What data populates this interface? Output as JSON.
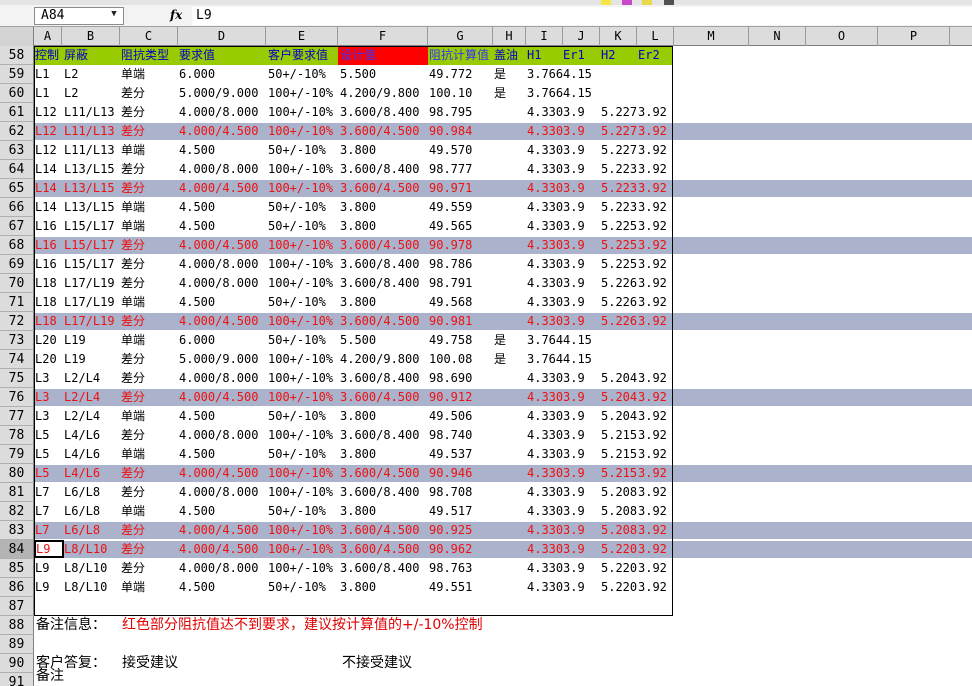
{
  "formula_bar": {
    "name_box": "A84",
    "fx_label": "fx",
    "formula": "L9"
  },
  "columns": [
    "A",
    "B",
    "C",
    "D",
    "E",
    "F",
    "G",
    "H",
    "I",
    "J",
    "K",
    "L",
    "M",
    "N",
    "O",
    "P"
  ],
  "colors": {
    "header_band": "#99cc00",
    "header_text": "#0000cc",
    "highlight_band": "#aab2cc",
    "highlight_text": "#ee1111",
    "header_red_fill": "#ff0000"
  },
  "header_row": {
    "row": "58",
    "cells": [
      "控制",
      "屏蔽",
      "阻抗类型",
      "要求值",
      "客户要求值",
      "设计值",
      "阻抗计算值",
      "盖油",
      "H1",
      "Er1",
      "H2",
      "Er2"
    ]
  },
  "rows": [
    {
      "row": "59",
      "hl": false,
      "cells": [
        "L1",
        "L2",
        "单端",
        "6.000",
        "50+/-10%",
        "5.500",
        "49.772",
        "是",
        "3.766",
        "4.15",
        "",
        ""
      ]
    },
    {
      "row": "60",
      "hl": false,
      "cells": [
        "L1",
        "L2",
        "差分",
        "5.000/9.000",
        "100+/-10%",
        "4.200/9.800",
        "100.10",
        "是",
        "3.766",
        "4.15",
        "",
        ""
      ]
    },
    {
      "row": "61",
      "hl": false,
      "cells": [
        "L12",
        "L11/L13",
        "差分",
        "4.000/8.000",
        "100+/-10%",
        "3.600/8.400",
        "98.795",
        "",
        "4.330",
        "3.9",
        "5.227",
        "3.92"
      ]
    },
    {
      "row": "62",
      "hl": true,
      "cells": [
        "L12",
        "L11/L13",
        "差分",
        "4.000/4.500",
        "100+/-10%",
        "3.600/4.500",
        "90.984",
        "",
        "4.330",
        "3.9",
        "5.227",
        "3.92"
      ]
    },
    {
      "row": "63",
      "hl": false,
      "cells": [
        "L12",
        "L11/L13",
        "单端",
        "4.500",
        "50+/-10%",
        "3.800",
        "49.570",
        "",
        "4.330",
        "3.9",
        "5.227",
        "3.92"
      ]
    },
    {
      "row": "64",
      "hl": false,
      "cells": [
        "L14",
        "L13/L15",
        "差分",
        "4.000/8.000",
        "100+/-10%",
        "3.600/8.400",
        "98.777",
        "",
        "4.330",
        "3.9",
        "5.223",
        "3.92"
      ]
    },
    {
      "row": "65",
      "hl": true,
      "cells": [
        "L14",
        "L13/L15",
        "差分",
        "4.000/4.500",
        "100+/-10%",
        "3.600/4.500",
        "90.971",
        "",
        "4.330",
        "3.9",
        "5.223",
        "3.92"
      ]
    },
    {
      "row": "66",
      "hl": false,
      "cells": [
        "L14",
        "L13/L15",
        "单端",
        "4.500",
        "50+/-10%",
        "3.800",
        "49.559",
        "",
        "4.330",
        "3.9",
        "5.223",
        "3.92"
      ]
    },
    {
      "row": "67",
      "hl": false,
      "cells": [
        "L16",
        "L15/L17",
        "单端",
        "4.500",
        "50+/-10%",
        "3.800",
        "49.565",
        "",
        "4.330",
        "3.9",
        "5.225",
        "3.92"
      ]
    },
    {
      "row": "68",
      "hl": true,
      "cells": [
        "L16",
        "L15/L17",
        "差分",
        "4.000/4.500",
        "100+/-10%",
        "3.600/4.500",
        "90.978",
        "",
        "4.330",
        "3.9",
        "5.225",
        "3.92"
      ]
    },
    {
      "row": "69",
      "hl": false,
      "cells": [
        "L16",
        "L15/L17",
        "差分",
        "4.000/8.000",
        "100+/-10%",
        "3.600/8.400",
        "98.786",
        "",
        "4.330",
        "3.9",
        "5.225",
        "3.92"
      ]
    },
    {
      "row": "70",
      "hl": false,
      "cells": [
        "L18",
        "L17/L19",
        "差分",
        "4.000/8.000",
        "100+/-10%",
        "3.600/8.400",
        "98.791",
        "",
        "4.330",
        "3.9",
        "5.226",
        "3.92"
      ]
    },
    {
      "row": "71",
      "hl": false,
      "cells": [
        "L18",
        "L17/L19",
        "单端",
        "4.500",
        "50+/-10%",
        "3.800",
        "49.568",
        "",
        "4.330",
        "3.9",
        "5.226",
        "3.92"
      ]
    },
    {
      "row": "72",
      "hl": true,
      "cells": [
        "L18",
        "L17/L19",
        "差分",
        "4.000/4.500",
        "100+/-10%",
        "3.600/4.500",
        "90.981",
        "",
        "4.330",
        "3.9",
        "5.226",
        "3.92"
      ]
    },
    {
      "row": "73",
      "hl": false,
      "cells": [
        "L20",
        "L19",
        "单端",
        "6.000",
        "50+/-10%",
        "5.500",
        "49.758",
        "是",
        "3.764",
        "4.15",
        "",
        ""
      ]
    },
    {
      "row": "74",
      "hl": false,
      "cells": [
        "L20",
        "L19",
        "差分",
        "5.000/9.000",
        "100+/-10%",
        "4.200/9.800",
        "100.08",
        "是",
        "3.764",
        "4.15",
        "",
        ""
      ]
    },
    {
      "row": "75",
      "hl": false,
      "cells": [
        "L3",
        "L2/L4",
        "差分",
        "4.000/8.000",
        "100+/-10%",
        "3.600/8.400",
        "98.690",
        "",
        "4.330",
        "3.9",
        "5.204",
        "3.92"
      ]
    },
    {
      "row": "76",
      "hl": true,
      "cells": [
        "L3",
        "L2/L4",
        "差分",
        "4.000/4.500",
        "100+/-10%",
        "3.600/4.500",
        "90.912",
        "",
        "4.330",
        "3.9",
        "5.204",
        "3.92"
      ]
    },
    {
      "row": "77",
      "hl": false,
      "cells": [
        "L3",
        "L2/L4",
        "单端",
        "4.500",
        "50+/-10%",
        "3.800",
        "49.506",
        "",
        "4.330",
        "3.9",
        "5.204",
        "3.92"
      ]
    },
    {
      "row": "78",
      "hl": false,
      "cells": [
        "L5",
        "L4/L6",
        "差分",
        "4.000/8.000",
        "100+/-10%",
        "3.600/8.400",
        "98.740",
        "",
        "4.330",
        "3.9",
        "5.215",
        "3.92"
      ]
    },
    {
      "row": "79",
      "hl": false,
      "cells": [
        "L5",
        "L4/L6",
        "单端",
        "4.500",
        "50+/-10%",
        "3.800",
        "49.537",
        "",
        "4.330",
        "3.9",
        "5.215",
        "3.92"
      ]
    },
    {
      "row": "80",
      "hl": true,
      "cells": [
        "L5",
        "L4/L6",
        "差分",
        "4.000/4.500",
        "100+/-10%",
        "3.600/4.500",
        "90.946",
        "",
        "4.330",
        "3.9",
        "5.215",
        "3.92"
      ]
    },
    {
      "row": "81",
      "hl": false,
      "cells": [
        "L7",
        "L6/L8",
        "差分",
        "4.000/8.000",
        "100+/-10%",
        "3.600/8.400",
        "98.708",
        "",
        "4.330",
        "3.9",
        "5.208",
        "3.92"
      ]
    },
    {
      "row": "82",
      "hl": false,
      "cells": [
        "L7",
        "L6/L8",
        "单端",
        "4.500",
        "50+/-10%",
        "3.800",
        "49.517",
        "",
        "4.330",
        "3.9",
        "5.208",
        "3.92"
      ]
    },
    {
      "row": "83",
      "hl": true,
      "cells": [
        "L7",
        "L6/L8",
        "差分",
        "4.000/4.500",
        "100+/-10%",
        "3.600/4.500",
        "90.925",
        "",
        "4.330",
        "3.9",
        "5.208",
        "3.92"
      ]
    },
    {
      "row": "84",
      "hl": true,
      "cells": [
        "L9",
        "L8/L10",
        "差分",
        "4.000/4.500",
        "100+/-10%",
        "3.600/4.500",
        "90.962",
        "",
        "4.330",
        "3.9",
        "5.220",
        "3.92"
      ]
    },
    {
      "row": "85",
      "hl": false,
      "cells": [
        "L9",
        "L8/L10",
        "差分",
        "4.000/8.000",
        "100+/-10%",
        "3.600/8.400",
        "98.763",
        "",
        "4.330",
        "3.9",
        "5.220",
        "3.92"
      ]
    },
    {
      "row": "86",
      "hl": false,
      "cells": [
        "L9",
        "L8/L10",
        "单端",
        "4.500",
        "50+/-10%",
        "3.800",
        "49.551",
        "",
        "4.330",
        "3.9",
        "5.220",
        "3.92"
      ]
    }
  ],
  "notes": {
    "r87": "87",
    "r88": "88",
    "note_label": "备注信息：",
    "note_text": "红色部分阻抗值达不到要求，建议按计算值的+/-10%控制",
    "r89": "89",
    "r90": "90",
    "reply_label": "客户答复：",
    "accept": "接受建议",
    "reject": "不接受建议",
    "r91": "91",
    "remark": "备注"
  }
}
